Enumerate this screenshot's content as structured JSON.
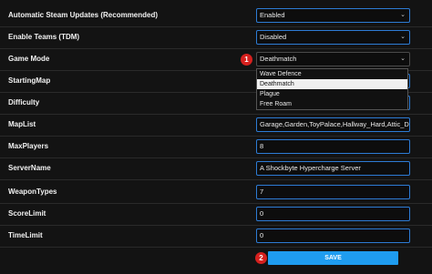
{
  "settings": [
    {
      "label": "Automatic Steam Updates (Recommended)",
      "value": "Enabled",
      "type": "select"
    },
    {
      "label": "Enable Teams (TDM)",
      "value": "Disabled",
      "type": "select"
    },
    {
      "label": "Game Mode",
      "value": "Deathmatch",
      "type": "select"
    },
    {
      "label": "StartingMap",
      "value": "",
      "type": "select"
    },
    {
      "label": "Difficulty",
      "value": "",
      "type": "select"
    },
    {
      "label": "MapList",
      "value": "Garage,Garden,ToyPalace,Hallway_Hard,Attic_Day",
      "type": "text"
    },
    {
      "label": "MaxPlayers",
      "value": "8",
      "type": "text"
    },
    {
      "label": "ServerName",
      "value": "A Shockbyte Hypercharge Server",
      "type": "text"
    },
    {
      "label": "WeaponTypes",
      "value": "7",
      "type": "text"
    },
    {
      "label": "ScoreLimit",
      "value": "0",
      "type": "text"
    },
    {
      "label": "TimeLimit",
      "value": "0",
      "type": "text"
    }
  ],
  "game_mode_dropdown": {
    "options": [
      "Wave Defence",
      "Deathmatch",
      "Plague",
      "Free Roam"
    ],
    "selected": "Deathmatch"
  },
  "badges": {
    "one": "1",
    "two": "2"
  },
  "save_label": "SAVE",
  "colors": {
    "background": "#131313",
    "field_border": "#2d7bd4",
    "save_button": "#1f9cf0",
    "badge": "#d6201e"
  }
}
